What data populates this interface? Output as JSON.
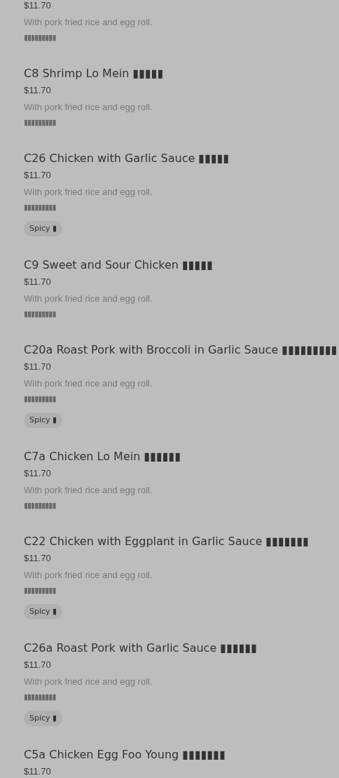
{
  "items": [
    {
      "price": "$11.70",
      "description": "With pork fried rice and egg roll.",
      "note": "▮▮▮▮▮▮▮▮▮"
    },
    {
      "title": "C8 Shrimp Lo Mein ▮▮▮▮▮",
      "price": "$11.70",
      "description": "With pork fried rice and egg roll.",
      "note": "▮▮▮▮▮▮▮▮▮"
    },
    {
      "title": "C26 Chicken with Garlic Sauce ▮▮▮▮▮",
      "price": "$11.70",
      "description": "With pork fried rice and egg roll.",
      "note": "▮▮▮▮▮▮▮▮▮",
      "tag": "Spicy ▮"
    },
    {
      "title": "C9 Sweet and Sour Chicken ▮▮▮▮▮",
      "price": "$11.70",
      "description": "With pork fried rice and egg roll.",
      "note": "▮▮▮▮▮▮▮▮▮"
    },
    {
      "title": "C20a Roast Pork with Broccoli in Garlic Sauce ▮▮▮▮▮▮▮▮▮",
      "price": "$11.70",
      "description": "With pork fried rice and egg roll.",
      "note": "▮▮▮▮▮▮▮▮▮",
      "tag": "Spicy ▮"
    },
    {
      "title": "C7a Chicken Lo Mein ▮▮▮▮▮▮",
      "price": "$11.70",
      "description": "With pork fried rice and egg roll.",
      "note": "▮▮▮▮▮▮▮▮▮"
    },
    {
      "title": "C22 Chicken with Eggplant in Garlic Sauce ▮▮▮▮▮▮▮",
      "price": "$11.70",
      "description": "With pork fried rice and egg roll.",
      "note": "▮▮▮▮▮▮▮▮▮",
      "tag": "Spicy ▮"
    },
    {
      "title": "C26a Roast Pork with Garlic Sauce ▮▮▮▮▮▮",
      "price": "$11.70",
      "description": "With pork fried rice and egg roll.",
      "note": "▮▮▮▮▮▮▮▮▮",
      "tag": "Spicy ▮"
    },
    {
      "title": "C5a Chicken Egg Foo Young ▮▮▮▮▮▮▮",
      "price": "$11.70"
    }
  ]
}
